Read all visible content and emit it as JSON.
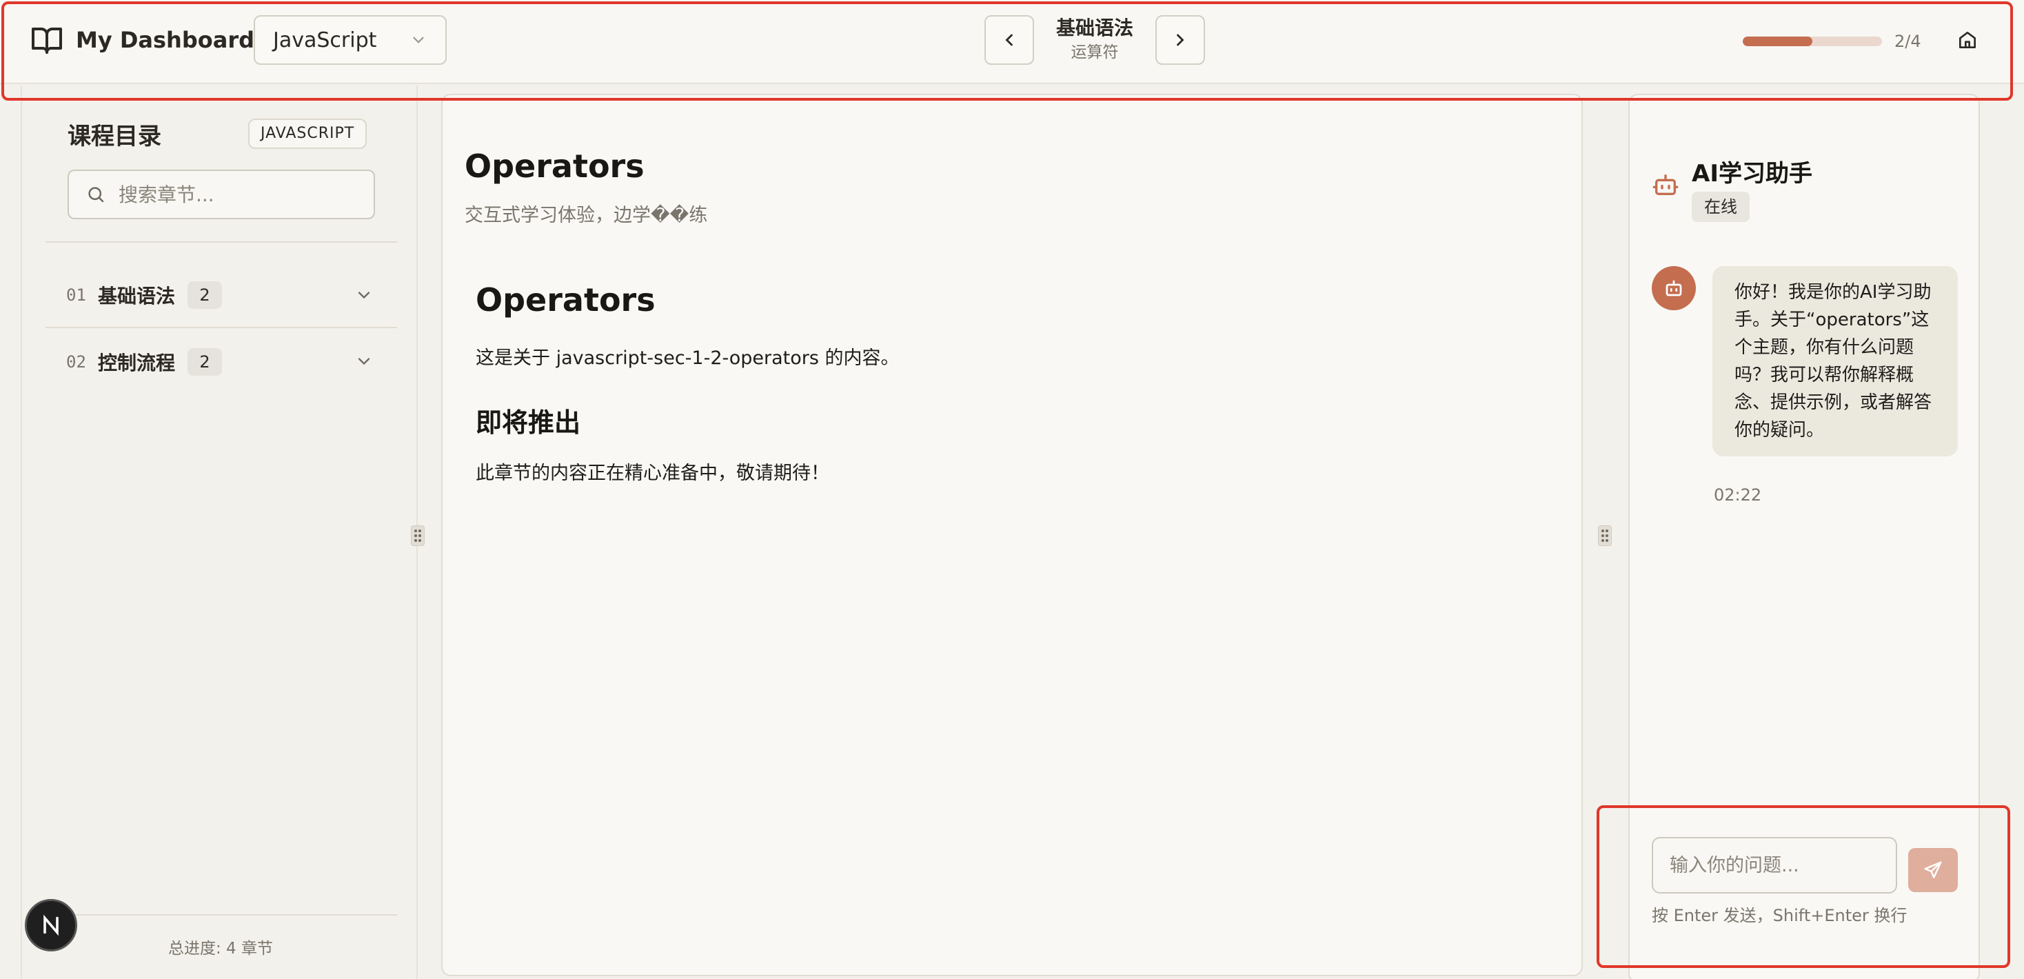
{
  "header": {
    "brand_title": "My Dashboard",
    "language_selected": "JavaScript",
    "crumb_title": "基础语法",
    "crumb_subtitle": "运算符",
    "progress_text": "2/4",
    "progress_fraction": 0.5,
    "accent_color": "#c46d4f"
  },
  "sidebar": {
    "title": "课程目录",
    "language_tag": "JAVASCRIPT",
    "search_placeholder": "搜索章节...",
    "chapters": [
      {
        "num": "01",
        "name": "基础语法",
        "count": "2"
      },
      {
        "num": "02",
        "name": "控制流程",
        "count": "2"
      }
    ],
    "footer": "总进度: 4 章节"
  },
  "main": {
    "title": "Operators",
    "subtitle": "交互式学习体验，边学��练",
    "article": {
      "heading": "Operators",
      "intro": "这是关于 javascript-sec-1-2-operators 的内容。",
      "subheading": "即将推出",
      "body": "此章节的内容正在精心准备中，敬请期待！"
    }
  },
  "chat": {
    "title": "AI学习助手",
    "status": "在线",
    "message": "你好！我是你的AI学习助手。关于“operators”这个主题，你有什么问题吗？我可以帮你解释概念、提供示例，或者解答你的疑问。",
    "time": "02:22",
    "input_placeholder": "输入你的问题...",
    "hint": "按 Enter 发送，Shift+Enter 换行"
  },
  "icons": {
    "brand": "book-open-icon",
    "select": "chevron-down-icon",
    "prev": "chevron-left-icon",
    "next": "chevron-right-icon",
    "home": "home-icon",
    "search": "search-icon",
    "bot": "bot-icon",
    "send": "send-icon",
    "framework": "n-logo-icon"
  }
}
